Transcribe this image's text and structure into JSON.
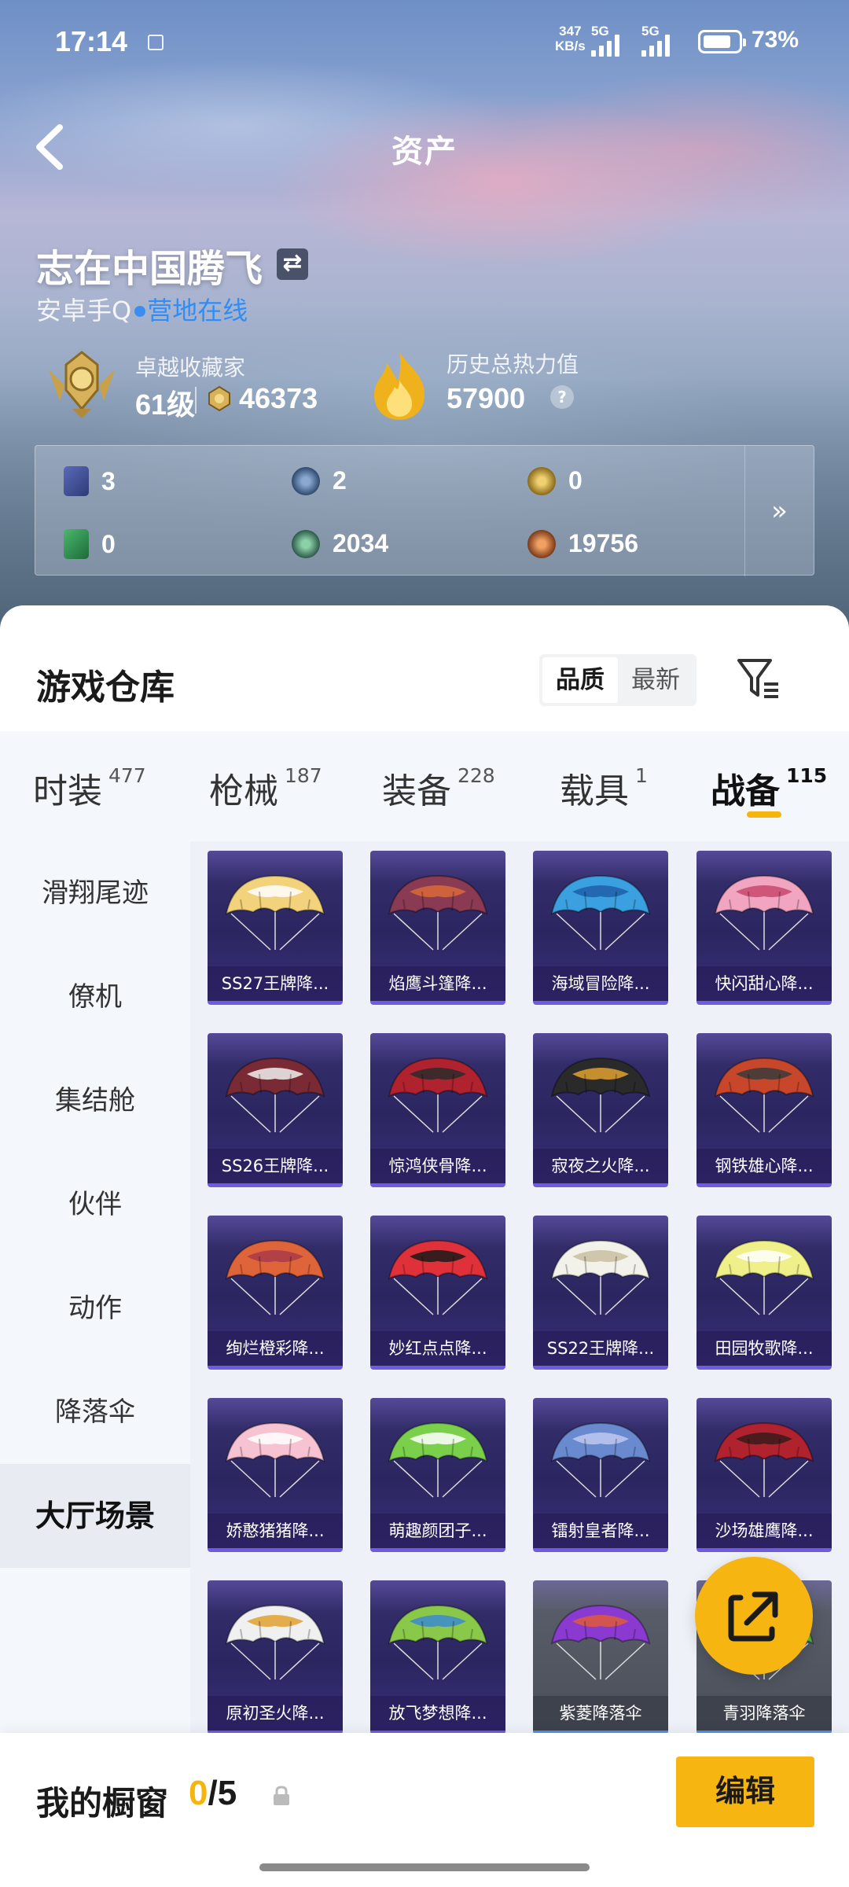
{
  "status": {
    "time": "17:14",
    "speed_value": "347",
    "speed_unit": "KB/s",
    "network1": "5G",
    "network2": "5G",
    "battery": "73%"
  },
  "header": {
    "title": "资产"
  },
  "profile": {
    "name": "志在中国腾飞",
    "platform": "安卓手Q",
    "online_status": "营地在线",
    "rank_title": "卓越收藏家",
    "level": "61级",
    "coins": "46373",
    "heat_title": "历史总热力值",
    "heat_value": "57900",
    "help": "?"
  },
  "resources": [
    {
      "name": "purple-card",
      "value": "3",
      "color": "#4a5c9e"
    },
    {
      "name": "blue-token",
      "value": "2",
      "color": "#3d5f86"
    },
    {
      "name": "gold-token",
      "value": "0",
      "color": "#b08a2a"
    },
    {
      "name": "green-card",
      "value": "0",
      "color": "#2f8a4d"
    },
    {
      "name": "green-token",
      "value": "2034",
      "color": "#3c7f5f"
    },
    {
      "name": "bronze-token",
      "value": "19756",
      "color": "#a25a2a"
    }
  ],
  "resources_more": "»",
  "warehouse": {
    "title": "游戏仓库",
    "sort_options": [
      "品质",
      "最新"
    ],
    "sort_selected": "品质",
    "tabs": [
      {
        "label": "时装",
        "count": "477"
      },
      {
        "label": "枪械",
        "count": "187"
      },
      {
        "label": "装备",
        "count": "228"
      },
      {
        "label": "载具",
        "count": "1"
      },
      {
        "label": "战备",
        "count": "115"
      }
    ],
    "active_tab": "战备",
    "side_nav": [
      "滑翔尾迹",
      "僚机",
      "集结舱",
      "伙伴",
      "动作",
      "降落伞",
      "大厅场景"
    ],
    "active_side": "大厅场景",
    "items": [
      {
        "label": "SS27王牌降...",
        "c1": "#f2d27a",
        "c2": "#ffffff",
        "grey": false
      },
      {
        "label": "焰鹰斗篷降...",
        "c1": "#8a3a52",
        "c2": "#d86a3a",
        "grey": false
      },
      {
        "label": "海域冒险降...",
        "c1": "#3aa0e0",
        "c2": "#1e5fa8",
        "grey": false
      },
      {
        "label": "快闪甜心降...",
        "c1": "#f2a5c0",
        "c2": "#c8486e",
        "grey": false
      },
      {
        "label": "SS26王牌降...",
        "c1": "#7a2a34",
        "c2": "#f0f0f0",
        "grey": false
      },
      {
        "label": "惊鸿侠骨降...",
        "c1": "#b0222e",
        "c2": "#2a2a2a",
        "grey": false
      },
      {
        "label": "寂夜之火降...",
        "c1": "#2a2a2a",
        "c2": "#e0a030",
        "grey": false
      },
      {
        "label": "钢铁雄心降...",
        "c1": "#c8472a",
        "c2": "#3a3a3a",
        "grey": false
      },
      {
        "label": "绚烂橙彩降...",
        "c1": "#e0643a",
        "c2": "#a83a4a",
        "grey": false
      },
      {
        "label": "妙红点点降...",
        "c1": "#e0303a",
        "c2": "#1a1a1a",
        "grey": false
      },
      {
        "label": "SS22王牌降...",
        "c1": "#f2f2ea",
        "c2": "#c8c0a0",
        "grey": false
      },
      {
        "label": "田园牧歌降...",
        "c1": "#f0f08a",
        "c2": "#ffffff",
        "grey": false
      },
      {
        "label": "娇憨猪猪降...",
        "c1": "#f7c2d2",
        "c2": "#ffffff",
        "grey": false
      },
      {
        "label": "萌趣颜团子...",
        "c1": "#7ad04a",
        "c2": "#ffffff",
        "grey": false
      },
      {
        "label": "镭射皇者降...",
        "c1": "#6a8ad0",
        "c2": "#c0c8f0",
        "grey": false
      },
      {
        "label": "沙场雄鹰降...",
        "c1": "#b0222e",
        "c2": "#3a1a1a",
        "grey": false
      },
      {
        "label": "原初圣火降...",
        "c1": "#f0f0f0",
        "c2": "#e0a030",
        "grey": false
      },
      {
        "label": "放飞梦想降...",
        "c1": "#8ac84a",
        "c2": "#3a8ad0",
        "grey": false
      },
      {
        "label": "紫菱降落伞",
        "c1": "#8a3ad0",
        "c2": "#e05a3a",
        "grey": true
      },
      {
        "label": "青羽降落伞",
        "c1": "#5ac04a",
        "c2": "#3a7a3a",
        "grey": true
      }
    ]
  },
  "showcase": {
    "label": "我的橱窗",
    "current": "0",
    "total": "/5",
    "edit_label": "编辑"
  },
  "accent_color": "#f5b50e"
}
